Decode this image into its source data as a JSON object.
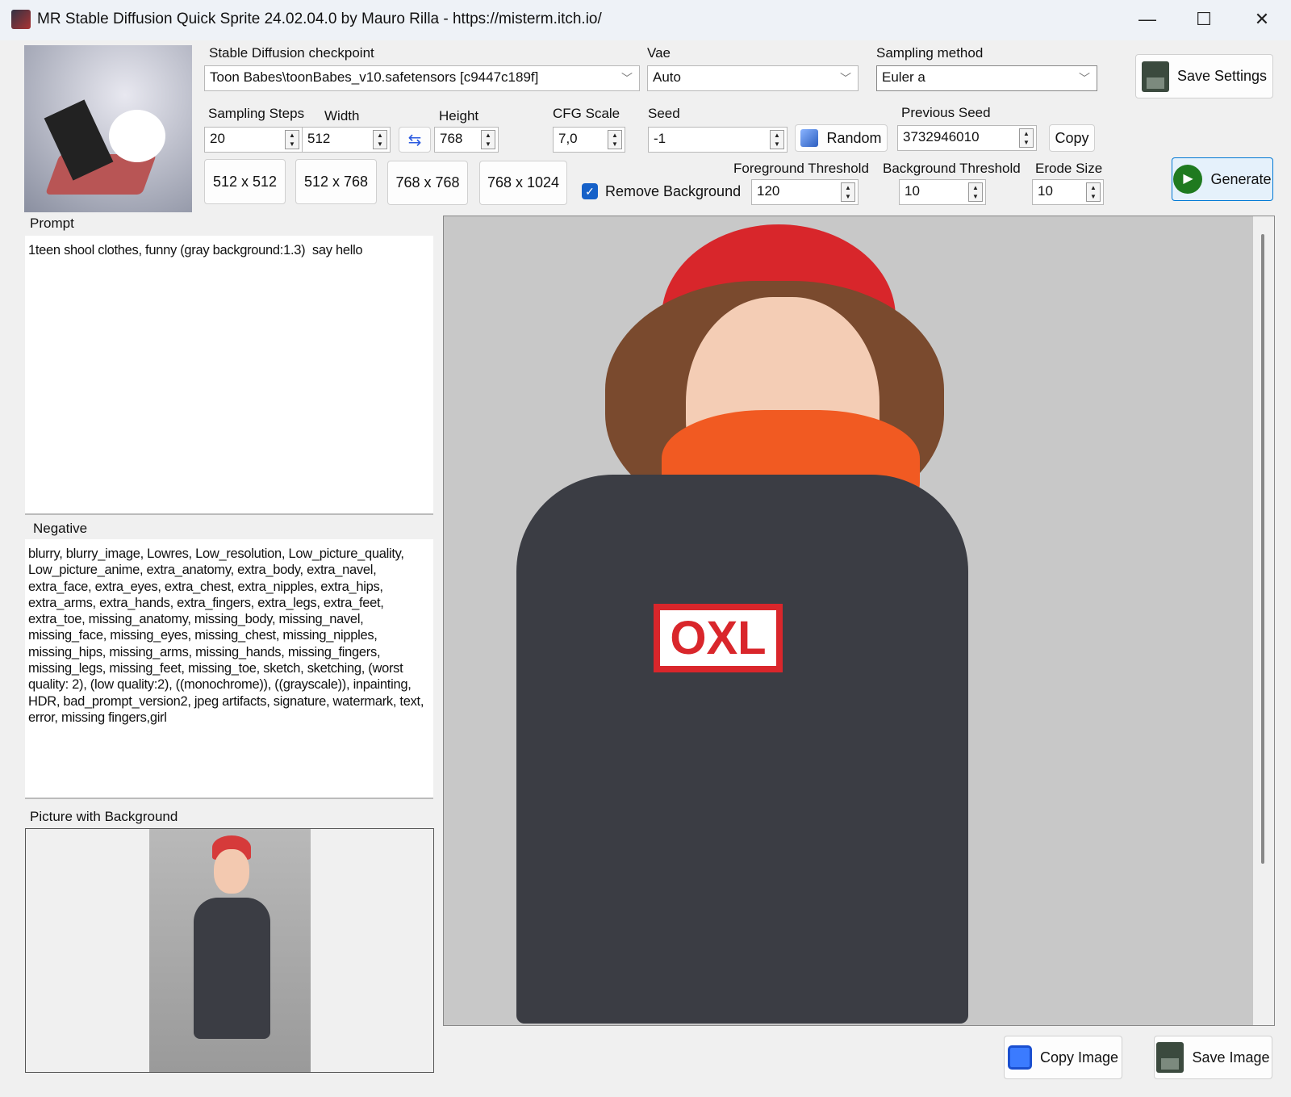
{
  "window": {
    "title": "MR Stable Diffusion Quick Sprite 24.02.04.0 by Mauro Rilla - https://misterm.itch.io/",
    "minimize": "—",
    "maximize": "☐",
    "close": "✕"
  },
  "checkpoint": {
    "label": "Stable Diffusion checkpoint",
    "value": "Toon Babes\\toonBabes_v10.safetensors [c9447c189f]"
  },
  "vae": {
    "label": "Vae",
    "value": "Auto"
  },
  "sampling_method": {
    "label": "Sampling method",
    "value": "Euler a"
  },
  "save_settings": "Save Settings",
  "sampling_steps": {
    "label": "Sampling Steps",
    "value": "20"
  },
  "width": {
    "label": "Width",
    "value": "512"
  },
  "height": {
    "label": "Height",
    "value": "768"
  },
  "cfg_scale": {
    "label": "CFG Scale",
    "value": "7,0"
  },
  "seed": {
    "label": "Seed",
    "value": "-1"
  },
  "random": "Random",
  "previous_seed": {
    "label": "Previous Seed",
    "value": "3732946010"
  },
  "copy": "Copy",
  "size_presets": [
    "512 x 512",
    "512 x 768",
    "768 x 768",
    "768 x 1024"
  ],
  "remove_background": {
    "label": "Remove Background",
    "checked": true
  },
  "foreground_threshold": {
    "label": "Foreground Threshold",
    "value": "120"
  },
  "background_threshold": {
    "label": "Background Threshold",
    "value": "10"
  },
  "erode_size": {
    "label": "Erode Size",
    "value": "10"
  },
  "generate": "Generate",
  "prompt": {
    "label": "Prompt",
    "value": "1teen shool clothes, funny (gray background:1.3)  say hello"
  },
  "negative": {
    "label": "Negative",
    "value": "blurry, blurry_image, Lowres, Low_resolution, Low_picture_quality, Low_picture_anime, extra_anatomy, extra_body, extra_navel, extra_face, extra_eyes, extra_chest, extra_nipples, extra_hips, extra_arms, extra_hands, extra_fingers, extra_legs, extra_feet, extra_toe, missing_anatomy, missing_body, missing_navel, missing_face, missing_eyes, missing_chest, missing_nipples, missing_hips, missing_arms, missing_hands, missing_fingers, missing_legs, missing_feet, missing_toe, sketch, sketching, (worst quality: 2), (low quality:2), ((monochrome)), ((grayscale)), inpainting, HDR, bad_prompt_version2, jpeg artifacts, signature, watermark, text, error, missing fingers,girl"
  },
  "picture_with_background": {
    "label": "Picture with Background"
  },
  "copy_image": "Copy Image",
  "save_image": "Save Image",
  "colors": {
    "accent": "#1560c8",
    "generate_icon": "#1f7a1f",
    "image_bg": "#c8c8c8"
  }
}
